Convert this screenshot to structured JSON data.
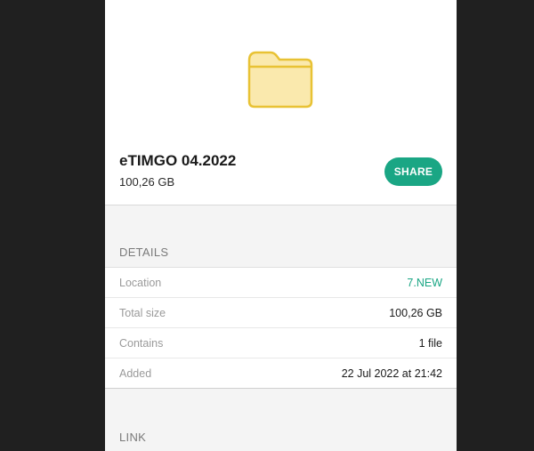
{
  "file": {
    "name": "eTIMGO 04.2022",
    "size": "100,26 GB",
    "share_label": "SHARE"
  },
  "details": {
    "title": "DETAILS",
    "rows": [
      {
        "label": "Location",
        "value": "7.NEW"
      },
      {
        "label": "Total size",
        "value": "100,26 GB"
      },
      {
        "label": "Contains",
        "value": "1 file"
      },
      {
        "label": "Added",
        "value": "22 Jul 2022 at 21:42"
      }
    ]
  },
  "link": {
    "title": "LINK"
  },
  "colors": {
    "accent": "#1aa684",
    "folder_fill": "#fae9ad",
    "folder_stroke": "#e8c234",
    "background": "#202020"
  },
  "icons": {
    "folder": "folder-icon"
  }
}
